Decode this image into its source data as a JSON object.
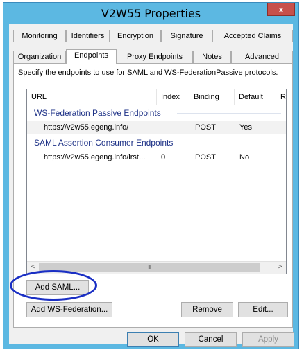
{
  "window": {
    "title": "V2W55  Properties",
    "close_label": "x"
  },
  "tabs": {
    "row1": [
      "Monitoring",
      "Identifiers",
      "Encryption",
      "Signature",
      "Accepted Claims"
    ],
    "row2": [
      "Organization",
      "Endpoints",
      "Proxy Endpoints",
      "Notes",
      "Advanced"
    ],
    "active": "Endpoints"
  },
  "panel": {
    "description": "Specify the endpoints to use for SAML and WS-FederationPassive protocols.",
    "columns": [
      "URL",
      "Index",
      "Binding",
      "Default",
      "Re"
    ],
    "groups": [
      {
        "title": "WS-Federation Passive Endpoints",
        "rows": [
          {
            "url": "https://v2w55.egeng.info/",
            "index": "",
            "binding": "POST",
            "default": "Yes"
          }
        ]
      },
      {
        "title": "SAML Assertion Consumer Endpoints",
        "rows": [
          {
            "url": "https://v2w55.egeng.info/irst...",
            "index": "0",
            "binding": "POST",
            "default": "No"
          }
        ]
      }
    ],
    "scroll": {
      "left": "<",
      "right": ">",
      "thumb": "III"
    },
    "buttons": {
      "add_saml": "Add SAML...",
      "add_wsfed": "Add WS-Federation...",
      "remove": "Remove",
      "edit": "Edit..."
    }
  },
  "footer": {
    "ok": "OK",
    "cancel": "Cancel",
    "apply": "Apply"
  },
  "annotation": {
    "color": "#1a2fc4",
    "target": "Add SAML..."
  }
}
